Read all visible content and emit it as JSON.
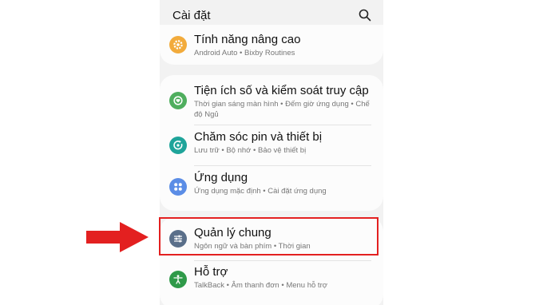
{
  "header": {
    "title": "Cài đặt"
  },
  "items": [
    {
      "label": "Tính năng nâng cao",
      "sub": "Android Auto  •  Bixby Routines",
      "icon": "gear-icon",
      "color": "#f2ab3c"
    },
    {
      "label": "Tiện ích số và kiểm soát truy cập",
      "sub": "Thời gian sáng màn hình  •  Đếm giờ ứng dụng  •  Chế độ Ngủ",
      "icon": "digital-wellbeing-icon",
      "color": "#4fae5e"
    },
    {
      "label": "Chăm sóc pin và thiết bị",
      "sub": "Lưu trữ  •  Bộ nhớ  •  Bảo vệ thiết bị",
      "icon": "device-care-icon",
      "color": "#1fa49a"
    },
    {
      "label": "Ứng dụng",
      "sub": "Ứng dụng mặc định  •  Cài đặt ứng dụng",
      "icon": "apps-icon",
      "color": "#5b8de6"
    },
    {
      "label": "Quản lý chung",
      "sub": "Ngôn ngữ và bàn phím  •  Thời gian",
      "icon": "sliders-icon",
      "color": "#5a6f8a"
    },
    {
      "label": "Hỗ trợ",
      "sub": "TalkBack  •  Âm thanh đơn  •  Menu hỗ trợ",
      "icon": "accessibility-icon",
      "color": "#2f9a49"
    }
  ],
  "annotation": {
    "arrow_color": "#e32020",
    "highlight_color": "#e32020"
  }
}
